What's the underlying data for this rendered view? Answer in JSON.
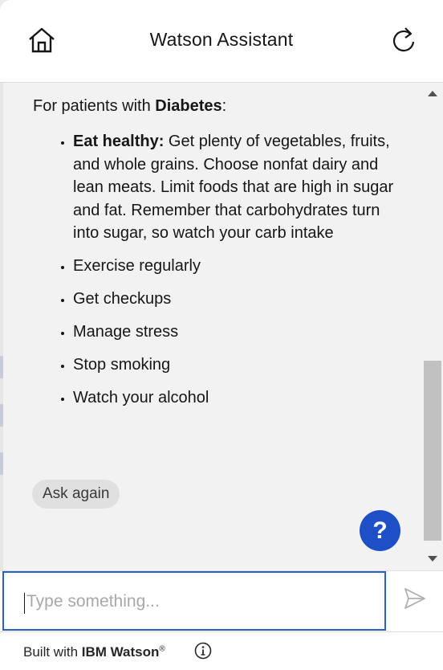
{
  "header": {
    "title": "Watson Assistant",
    "home_icon": "home-icon",
    "refresh_icon": "refresh-icon"
  },
  "message": {
    "intro_prefix": "For patients with ",
    "intro_bold": "Diabetes",
    "intro_suffix": ":",
    "items": [
      {
        "bold": "Eat healthy:",
        "text": " Get plenty of vegetables, fruits, and whole grains. Choose nonfat dairy and lean meats. Limit foods that are high in sugar and fat. Remember that carbohydrates turn into sugar, so watch your carb intake"
      },
      {
        "bold": "",
        "text": "Exercise regularly"
      },
      {
        "bold": "",
        "text": "Get checkups"
      },
      {
        "bold": "",
        "text": "Manage stress"
      },
      {
        "bold": "",
        "text": "Stop smoking"
      },
      {
        "bold": "",
        "text": "Watch your alcohol"
      }
    ],
    "ask_again_label": "Ask again"
  },
  "help_button": {
    "label": "?"
  },
  "input": {
    "placeholder": "Type something...",
    "value": "",
    "send_icon": "send-icon"
  },
  "footer": {
    "built_prefix": "Built with ",
    "brand": "IBM Watson",
    "reg_mark": "®",
    "info_icon": "info-icon"
  },
  "colors": {
    "accent": "#1f4fc4",
    "input_border": "#2b5fc7",
    "message_bg": "#f2f2f2"
  }
}
